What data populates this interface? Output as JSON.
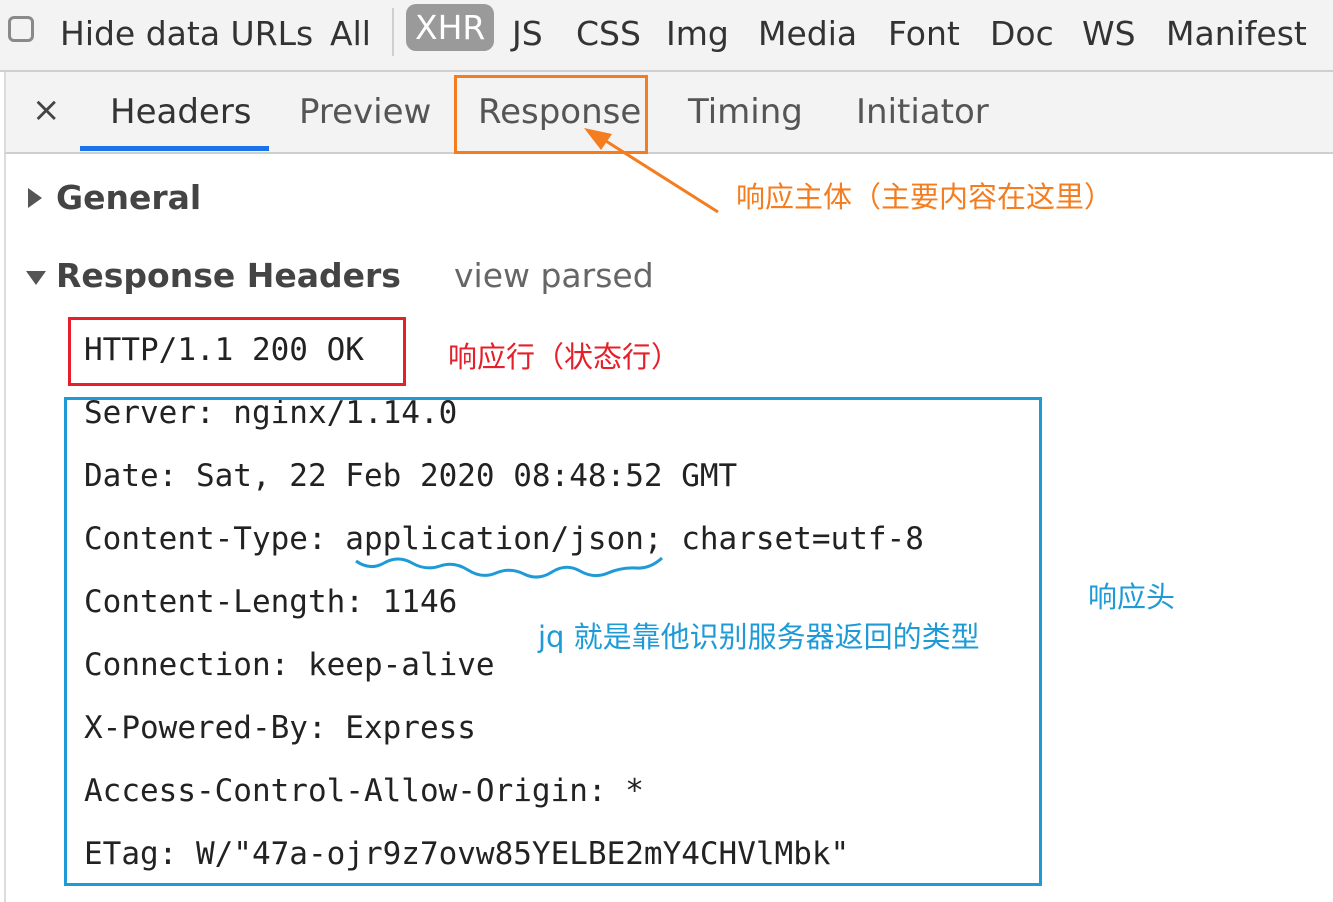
{
  "filterbar": {
    "hide_data_urls": "Hide data URLs",
    "hide_data_urls_checked": false,
    "filters": [
      "All",
      "XHR",
      "JS",
      "CSS",
      "Img",
      "Media",
      "Font",
      "Doc",
      "WS",
      "Manifest"
    ],
    "active_filter": "XHR"
  },
  "tabs": {
    "close": "×",
    "items": [
      "Headers",
      "Preview",
      "Response",
      "Timing",
      "Initiator"
    ],
    "selected": "Headers"
  },
  "sections": {
    "general": "General",
    "response_headers": "Response Headers",
    "view_parsed": "view parsed"
  },
  "status_line": "HTTP/1.1 200 OK",
  "headers": [
    "Server: nginx/1.14.0",
    "Date: Sat, 22 Feb 2020 08:48:52 GMT",
    "Content-Type: application/json; charset=utf-8",
    "Content-Length: 1146",
    "Connection: keep-alive",
    "X-Powered-By: Express",
    "Access-Control-Allow-Origin: *",
    "ETag: W/\"47a-ojr9z7ovw85YELBE2mY4CHVlMbk\""
  ],
  "annotations": {
    "response_body": "响应主体（主要内容在这里）",
    "status_line": "响应行（状态行）",
    "headers": "响应头",
    "content_type_note": "jq 就是靠他识别服务器返回的类型"
  },
  "colors": {
    "orange": "#f47d20",
    "red": "#e5202a",
    "blue": "#1e9bd7",
    "tab_underline": "#1a73e8"
  }
}
